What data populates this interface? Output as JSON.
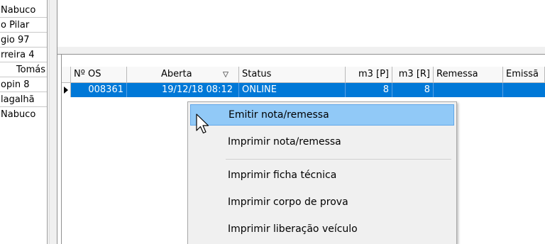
{
  "left_list": [
    "Nabuco",
    "o Pilar",
    "gio 97",
    "rreira 4",
    "Tomás",
    "opin 8",
    "lagalhã",
    "Nabuco"
  ],
  "grid": {
    "columns": [
      "Nº OS",
      "Aberta",
      "Status",
      "m3 [P]",
      "m3 [R]",
      "Remessa",
      "Emissã"
    ],
    "rows": [
      {
        "os": "008361",
        "aberta": "19/12/18 08:12",
        "status": "ONLINE",
        "m3p": "8",
        "m3r": "8",
        "remessa": "",
        "emissao": ""
      }
    ]
  },
  "context_menu": {
    "items": [
      "Emitir nota/remessa",
      "Imprimir nota/remessa",
      "Imprimir ficha técnica",
      "Imprimir corpo de prova",
      "Imprimir liberação veículo"
    ],
    "highlighted_index": 0
  },
  "colors": {
    "selection": "#0078d7",
    "menu_highlight": "#91c9f7"
  }
}
